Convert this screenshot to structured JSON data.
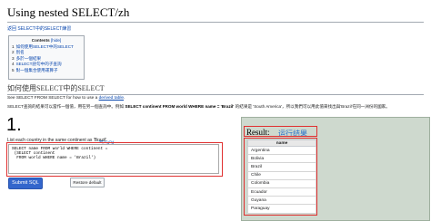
{
  "page": {
    "title": "Using nested SELECT/zh",
    "breadcrumb": "返回 SELECT中的SELECT練習"
  },
  "toc": {
    "heading": "Contents",
    "hide_label": "[hide]",
    "items": [
      {
        "num": "1",
        "label": "如何使用SELECT中的SELECT"
      },
      {
        "num": "2",
        "label": "別名"
      },
      {
        "num": "3",
        "label": "多於一個結果"
      },
      {
        "num": "4",
        "label": "SELECT語句中的子查詢"
      },
      {
        "num": "5",
        "label": "對一個集合使用運算子"
      }
    ]
  },
  "section": {
    "heading": "如何使用SELECT中的SELECT",
    "see_also_prefix": "See SELECT FROM SELECT for how to use a ",
    "see_also_link": "derived table",
    "see_also_suffix": ".",
    "query_line_start": "SELECT查詢的結果可以當作一個值，用在另一個查詢中。例如 ",
    "query_line_bold": "SELECT continent FROM world WHERE name = 'Brazil'",
    "query_line_mid": " 的結果是 ",
    "query_line_value": "'South America'",
    "query_line_end": "，所以我們可以用此值來找出與'Brazil'在同一洲份的國家。"
  },
  "exercise": {
    "number": "1.",
    "question": "List each country in the same continent as 'Brazil'.",
    "annotation": "写SQL",
    "code": "SELECT name FROM world WHERE continent = \n (SELECT continent\n  FROM world WHERE name = 'Brazil')",
    "submit_label": "Submit SQL",
    "restore_label": "Restore default"
  },
  "result": {
    "label": "Result:",
    "annotation": "运行结果",
    "column_header": "name",
    "rows": [
      "Argentina",
      "Bolivia",
      "Brazil",
      "Chile",
      "Colombia",
      "Ecuador",
      "Guyana",
      "Paraguay"
    ]
  }
}
